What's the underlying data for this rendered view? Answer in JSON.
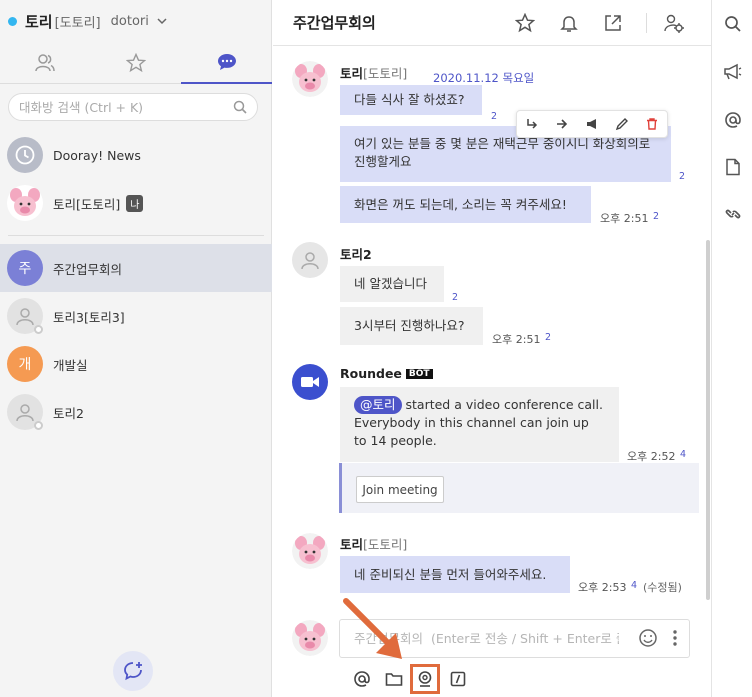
{
  "user": {
    "name": "토리",
    "tag": "[도토리]",
    "id": "dotori"
  },
  "sidebar": {
    "search_placeholder": "대화방 검색 (Ctrl + K)",
    "rooms": [
      {
        "label": "Dooray! News",
        "avatar": "clock-icon"
      },
      {
        "label": "토리[도토리]",
        "badge": "나",
        "avatar": "piglet-avatar"
      },
      {
        "label": "주간업무회의",
        "initial": "주",
        "color": "#7b80d6",
        "active": true
      },
      {
        "label": "토리3[토리3]",
        "avatar": "default-user"
      },
      {
        "label": "개발실",
        "initial": "개",
        "color": "#f59a52"
      },
      {
        "label": "토리2",
        "avatar": "default-user"
      }
    ]
  },
  "chat": {
    "title": "주간업무회의",
    "date": "2020.11.12 목요일",
    "messages": [
      {
        "sender": "토리",
        "tag": "[도토리]",
        "bubbles": [
          {
            "text": "다들 식사 잘 하셨죠?",
            "count": "2"
          },
          {
            "text": "여기 있는 분들 중 몇 분은 재택근무 중이시니 화상회의로 진행할게요",
            "count": "2"
          },
          {
            "text": "화면은 꺼도 되는데, 소리는 꼭 켜주세요!",
            "time": "오후 2:51",
            "count": "2"
          }
        ]
      },
      {
        "sender": "토리2",
        "bubbles": [
          {
            "text": "네 알겠습니다",
            "count": "2"
          },
          {
            "text": "3시부터 진행하나요?",
            "time": "오후 2:51",
            "count": "2"
          }
        ]
      },
      {
        "sender": "Roundee",
        "badge": "BOT",
        "mention": "@토리",
        "text": "started a video conference call. Everybody in this channel can join up to 14 people.",
        "time": "오후 2:52",
        "count": "4",
        "button": "Join meeting"
      },
      {
        "sender": "토리",
        "tag": "[도토리]",
        "bubbles": [
          {
            "text": "네 준비되신 분들 먼저 들어와주세요.",
            "time": "오후 2:53",
            "count": "4",
            "edited": "(수정됨)"
          }
        ]
      }
    ],
    "compose_placeholder": "주간업무회의  (Enter로 전송 / Shift + Enter로 줄바꿈)"
  },
  "colors": {
    "accent": "#4e55c8",
    "bubble": "#d9ddf7",
    "highlight": "#e06b3c"
  }
}
